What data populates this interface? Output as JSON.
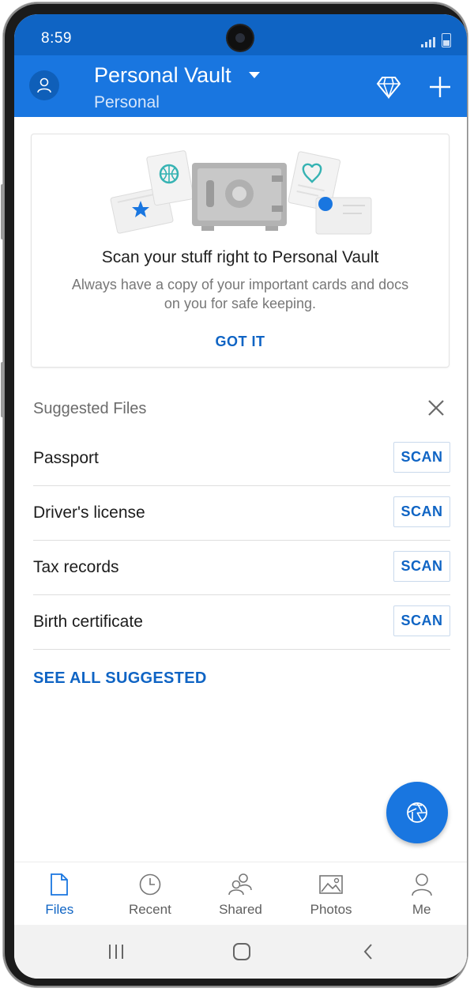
{
  "status": {
    "time": "8:59"
  },
  "header": {
    "title": "Personal Vault",
    "subtitle": "Personal"
  },
  "card": {
    "title": "Scan your stuff right to Personal Vault",
    "text": "Always have a copy of your important cards and docs on you for safe keeping.",
    "action": "GOT IT"
  },
  "suggested": {
    "heading": "Suggested Files",
    "items": [
      {
        "label": "Passport",
        "action": "SCAN"
      },
      {
        "label": "Driver's license",
        "action": "SCAN"
      },
      {
        "label": "Tax records",
        "action": "SCAN"
      },
      {
        "label": "Birth certificate",
        "action": "SCAN"
      }
    ],
    "see_all": "SEE ALL SUGGESTED"
  },
  "nav": {
    "items": [
      {
        "label": "Files",
        "icon": "file-icon",
        "active": true
      },
      {
        "label": "Recent",
        "icon": "clock-icon"
      },
      {
        "label": "Shared",
        "icon": "people-icon"
      },
      {
        "label": "Photos",
        "icon": "image-icon"
      },
      {
        "label": "Me",
        "icon": "person-icon"
      }
    ]
  },
  "colors": {
    "accent": "#1976e0",
    "status_bar": "#0f64c4",
    "link": "#0f64c4"
  }
}
